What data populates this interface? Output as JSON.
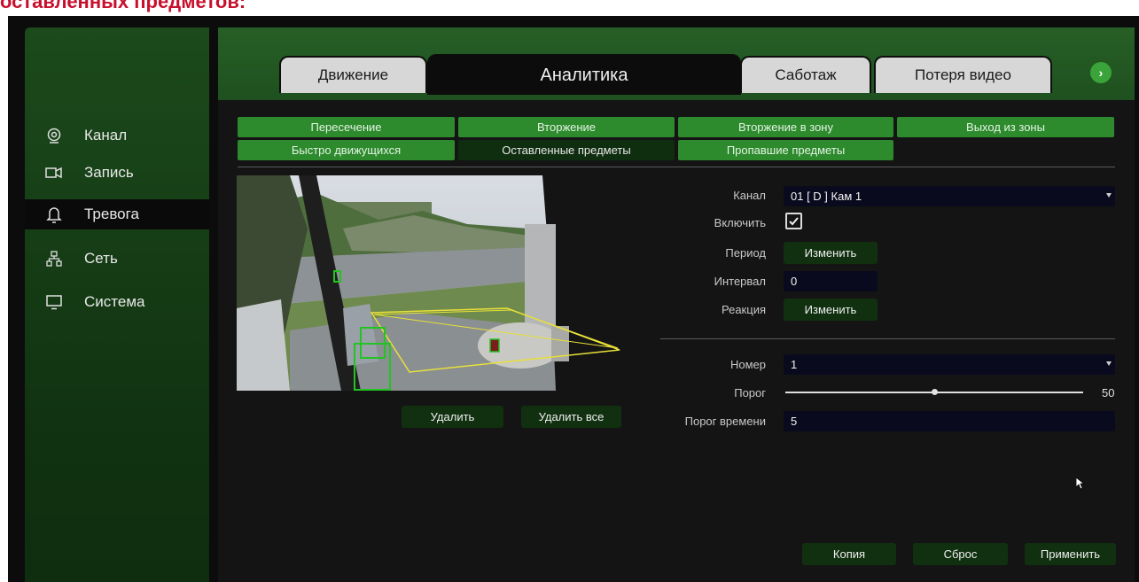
{
  "doc_heading": "оставленных предметов:",
  "sidebar": {
    "items": [
      {
        "label": "Канал",
        "icon": "camera-icon",
        "active": false
      },
      {
        "label": "Запись",
        "icon": "recorder-icon",
        "active": false
      },
      {
        "label": "Тревога",
        "icon": "bell-icon",
        "active": true
      },
      {
        "label": "Сеть",
        "icon": "network-icon",
        "active": false
      },
      {
        "label": "Система",
        "icon": "monitor-icon",
        "active": false
      }
    ]
  },
  "tabs": [
    {
      "label": "Движение",
      "active": false
    },
    {
      "label": "Аналитика",
      "active": true
    },
    {
      "label": "Саботаж",
      "active": false
    },
    {
      "label": "Потеря видео",
      "active": false
    }
  ],
  "tabs_next_icon": "chevron-right-icon",
  "subtabs": [
    {
      "label": "Пересечение",
      "active": false
    },
    {
      "label": "Вторжение",
      "active": false
    },
    {
      "label": "Вторжение в зону",
      "active": false
    },
    {
      "label": "Выход из зоны",
      "active": false
    },
    {
      "label": "Быстро движущихся",
      "active": false
    },
    {
      "label": "Оставленные предметы",
      "active": true
    },
    {
      "label": "Пропавшие предметы",
      "active": false
    }
  ],
  "preview": {
    "delete_label": "Удалить",
    "delete_all_label": "Удалить все"
  },
  "settings": {
    "channel_label": "Канал",
    "channel_value": "01 [ D ] Кам 1",
    "enable_label": "Включить",
    "enable_checked": true,
    "period_label": "Период",
    "period_button": "Изменить",
    "interval_label": "Интервал",
    "interval_value": "0",
    "reaction_label": "Реакция",
    "reaction_button": "Изменить",
    "number_label": "Номер",
    "number_value": "1",
    "threshold_label": "Порог",
    "threshold_value": "50",
    "threshold_fraction": 0.5,
    "time_threshold_label": "Порог времени",
    "time_threshold_value": "5"
  },
  "footer": {
    "copy_label": "Копия",
    "reset_label": "Сброс",
    "apply_label": "Применить"
  },
  "colors": {
    "accent_green": "#2d8a2d",
    "dark_green": "#103010",
    "zone_yellow": "#e8e03a",
    "detect_green": "#22c422"
  }
}
